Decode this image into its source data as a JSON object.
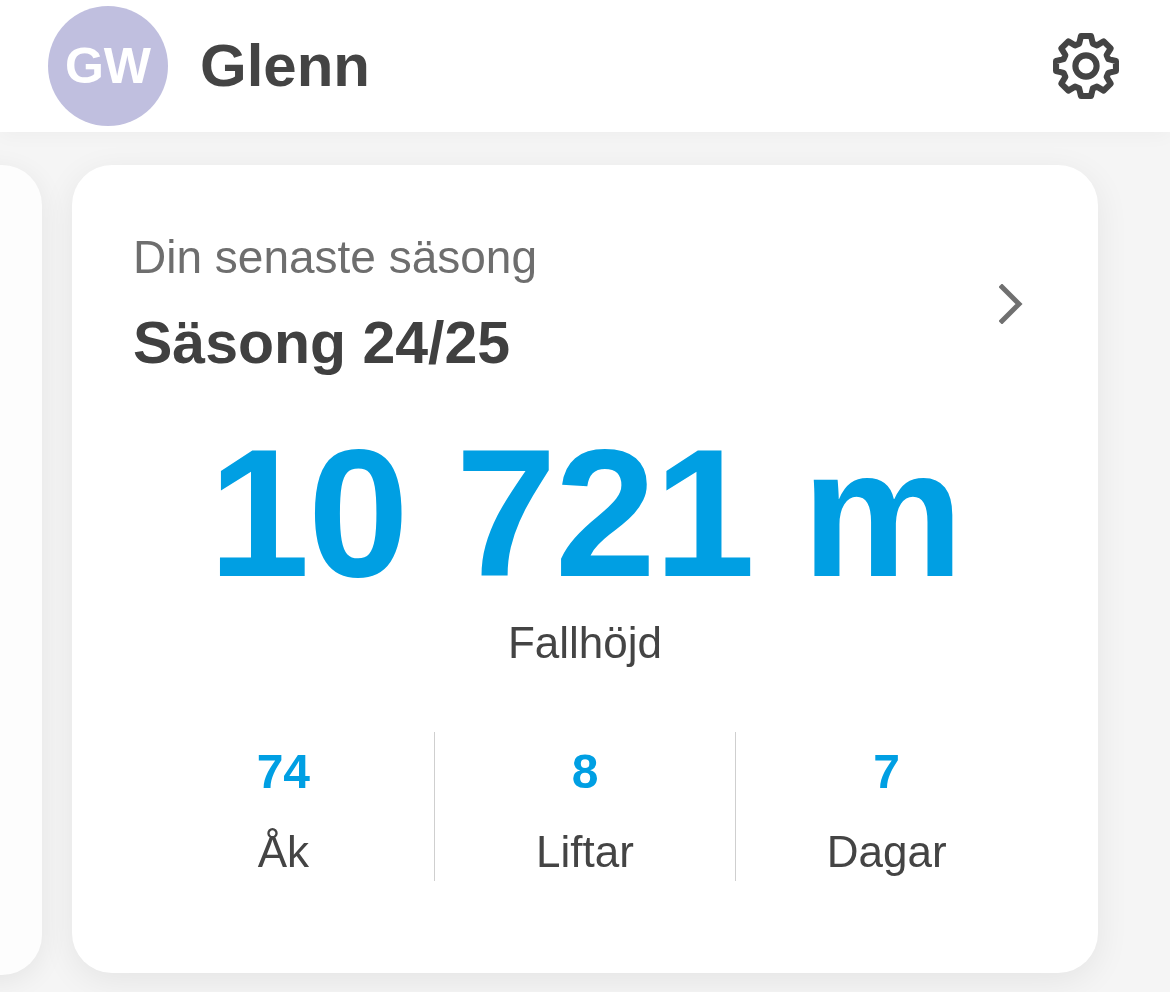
{
  "header": {
    "avatar_initials": "GW",
    "name": "Glenn"
  },
  "season_card": {
    "subtitle": "Din senaste säsong",
    "title": "Säsong 24/25",
    "headline_value": "10 721 m",
    "headline_label": "Fallhöjd",
    "stats": [
      {
        "value": "74",
        "label": "Åk"
      },
      {
        "value": "8",
        "label": "Liftar"
      },
      {
        "value": "7",
        "label": "Dagar"
      }
    ]
  }
}
